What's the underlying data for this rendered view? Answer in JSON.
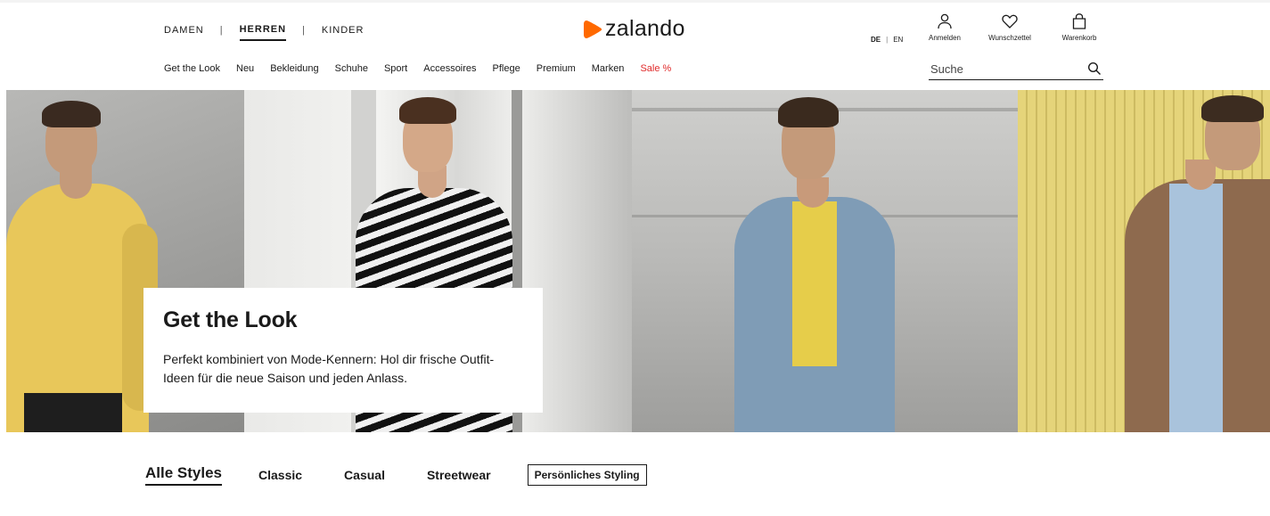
{
  "header": {
    "gender_tabs": [
      {
        "label": "DAMEN"
      },
      {
        "label": "HERREN",
        "active": true
      },
      {
        "label": "KINDER"
      }
    ],
    "separator": "|",
    "logo_text": "zalando",
    "brand_color": "#ff6900",
    "languages": {
      "de": "DE",
      "separator": "|",
      "en": "EN"
    },
    "account": {
      "login_label": "Anmelden",
      "login_icon": "user-icon",
      "wishlist_label": "Wunschzettel",
      "wishlist_icon": "heart-icon",
      "cart_label": "Warenkorb",
      "cart_icon": "bag-icon"
    },
    "nav": [
      "Get the Look",
      "Neu",
      "Bekleidung",
      "Schuhe",
      "Sport",
      "Accessoires",
      "Pflege",
      "Premium",
      "Marken",
      "Sale %"
    ],
    "sale_color": "#e02a2a",
    "search": {
      "placeholder": "Suche",
      "icon": "search-icon"
    }
  },
  "hero": {
    "title": "Get the Look",
    "text": "Perfekt kombiniert von Mode-Kennern: Hol dir frische Outfit-Ideen für die neue Saison und jeden Anlass."
  },
  "style_tabs": [
    {
      "label": "Alle Styles",
      "active": true
    },
    {
      "label": "Classic"
    },
    {
      "label": "Casual"
    },
    {
      "label": "Streetwear"
    },
    {
      "label": "Persönliches Styling",
      "boxed": true
    }
  ]
}
